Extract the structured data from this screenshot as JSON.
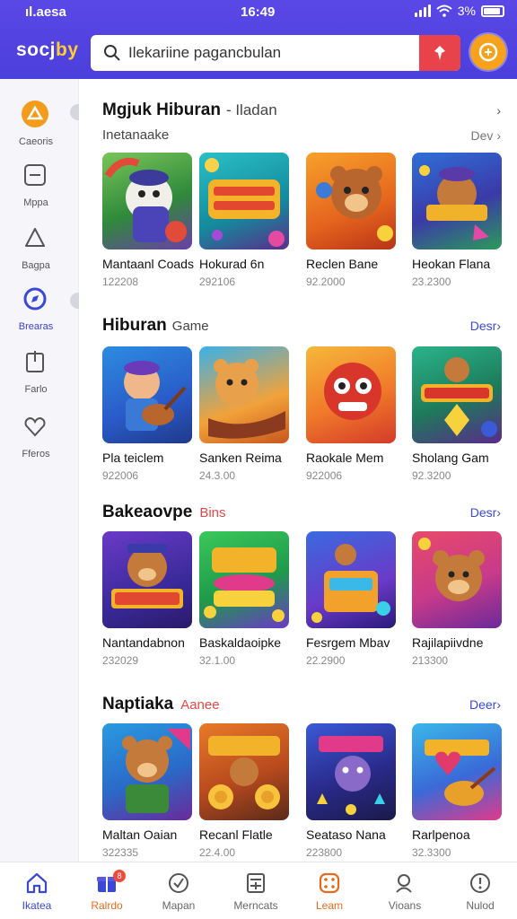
{
  "status_bar": {
    "left_text": "ıl.aesa",
    "time": "16:49",
    "battery_text": "3%"
  },
  "header": {
    "logo_main": "socj",
    "logo_accent": "by",
    "search": {
      "placeholder": "Ilekariine pagancbulan"
    }
  },
  "sidebar": {
    "items": [
      {
        "label": "Caeoris",
        "icon": "triangle-icon"
      },
      {
        "label": "Mppa",
        "icon": "minus-box-icon"
      },
      {
        "label": "Bagpa",
        "icon": "bag-icon"
      },
      {
        "label": "Brearas",
        "icon": "compass-icon"
      },
      {
        "label": "Farlo",
        "icon": "clipboard-icon"
      },
      {
        "label": "Fferos",
        "icon": "heart-icon"
      }
    ]
  },
  "sections": [
    {
      "title": "Mgjuk Hiburan",
      "title_suffix": "- Iladan",
      "subline": "Inetanaake",
      "more": "Dev",
      "cards": [
        {
          "name": "Mantaanl Coads",
          "count": "122208"
        },
        {
          "name": "Hokurad 6n",
          "count": "292106"
        },
        {
          "name": "Reclen Bane",
          "count": "92.2000"
        },
        {
          "name": "Heokan Flana",
          "count": "23.2300"
        }
      ]
    },
    {
      "title": "Hiburan",
      "title_suffix": "Game",
      "more": "Desr",
      "cards": [
        {
          "name": "Pla teiclem",
          "count": "922006"
        },
        {
          "name": "Sanken Reima",
          "count": "24.3.00"
        },
        {
          "name": "Raokale Mem",
          "count": "922006"
        },
        {
          "name": "Sholang Gam",
          "count": "92.3200"
        }
      ]
    },
    {
      "title": "Bakeaovpe",
      "title_red": "Bins",
      "more": "Desr",
      "cards": [
        {
          "name": "Nantandabnon",
          "count": "232029"
        },
        {
          "name": "Baskaldaoipke",
          "count": "32.1.00"
        },
        {
          "name": "Fesrgem Mbav",
          "count": "22.2900"
        },
        {
          "name": "Rajilapiivdne",
          "count": "213300"
        }
      ]
    },
    {
      "title": "Naptiaka",
      "title_red": "Aanee",
      "more": "Deer",
      "cards": [
        {
          "name": "Maltan Oaian",
          "count": "322335"
        },
        {
          "name": "Recanl Flatle",
          "count": "22.4.00"
        },
        {
          "name": "Seataso Nana",
          "count": "223800"
        },
        {
          "name": "Rarlpenoa",
          "count": "32.3300"
        }
      ]
    }
  ],
  "bottom_nav": {
    "items": [
      {
        "label": "Ikatea",
        "icon": "home-icon"
      },
      {
        "label": "Ralrdo",
        "icon": "gift-icon",
        "badge": "8"
      },
      {
        "label": "Mapan",
        "icon": "check-circle-icon"
      },
      {
        "label": "Merncats",
        "icon": "calculator-icon"
      },
      {
        "label": "Leam",
        "icon": "dice-icon"
      },
      {
        "label": "Vioans",
        "icon": "user-search-icon"
      },
      {
        "label": "Nulod",
        "icon": "info-icon"
      }
    ]
  },
  "colors": {
    "header": "#4b3fdc",
    "accent_blue": "#3b48d6",
    "search_button": "#e8424a",
    "avatar_button": "#f7a21b"
  }
}
